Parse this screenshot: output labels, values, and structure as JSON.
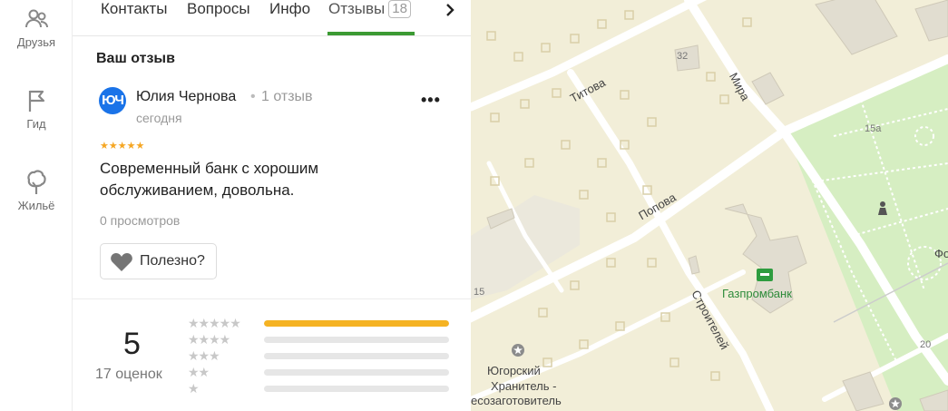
{
  "nav": {
    "items": [
      {
        "label": "Друзья",
        "icon": "friends-icon"
      },
      {
        "label": "Гид",
        "icon": "flag-icon"
      },
      {
        "label": "Жильё",
        "icon": "tree-icon"
      }
    ]
  },
  "tabs": {
    "items": [
      {
        "label": "Контакты"
      },
      {
        "label": "Вопросы"
      },
      {
        "label": "Инфо"
      },
      {
        "label": "Отзывы",
        "count": "18",
        "active": true
      }
    ],
    "next_icon": "chevron-right-icon"
  },
  "review": {
    "section_title": "Ваш отзыв",
    "avatar_text": "ЮЧ",
    "author": "Юлия Чернова",
    "separator": "•",
    "author_reviews": "1 отзыв",
    "date": "сегодня",
    "stars": "★★★★★",
    "rating": 5,
    "text": "Современный банк с хорошим обслуживанием, довольна.",
    "views": "0 просмотров",
    "helpful_label": "Полезно?",
    "more_label": "•••"
  },
  "summary": {
    "rating": "5",
    "count_label": "17 оценок",
    "distribution": [
      {
        "stars": "★★★★★",
        "fraction": 1.0
      },
      {
        "stars": "★★★★",
        "fraction": 0.0
      },
      {
        "stars": "★★★",
        "fraction": 0.0
      },
      {
        "stars": "★★",
        "fraction": 0.0
      },
      {
        "stars": "★",
        "fraction": 0.0
      }
    ]
  },
  "map": {
    "labels": {
      "street_titova": "Титова",
      "street_mira": "Мира",
      "street_popova": "Попова",
      "street_stroiteley": "Строителей",
      "poi_gazprombank": "Газпромбанк",
      "poi_yugorsky_1": "Югорский",
      "poi_yugorsky_2": "Хранитель -",
      "poi_yugorsky_3": "есозаготовитель",
      "house_32": "32",
      "house_15a": "15а",
      "house_15": "15",
      "house_20": "20",
      "partial_fo": "Фо"
    },
    "colors": {
      "land": "#f2eed8",
      "park": "#d6eec2",
      "building": "#e1ddd0",
      "road": "#ffffff",
      "accent": "#3b9a33"
    }
  }
}
